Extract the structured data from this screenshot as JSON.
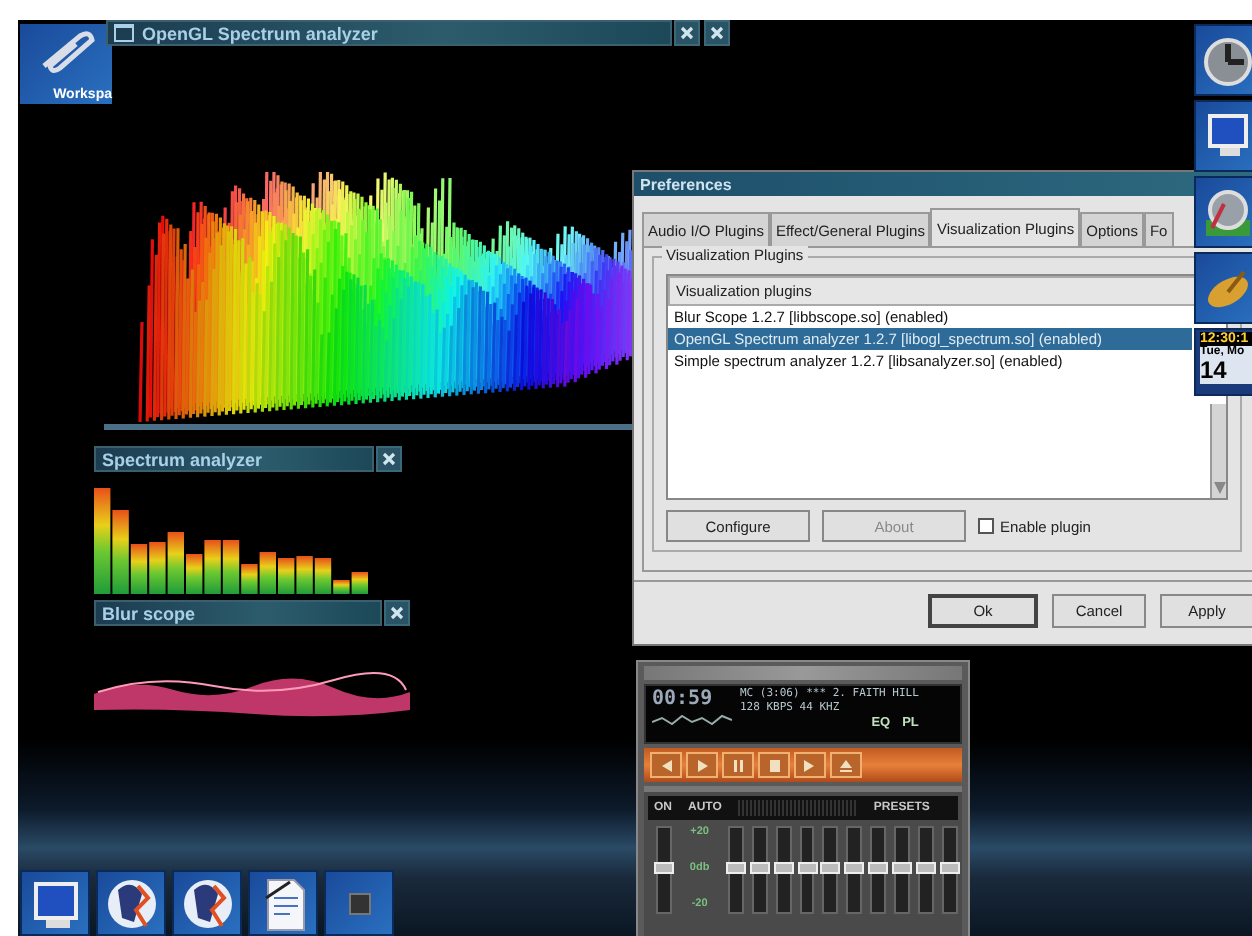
{
  "clip": {
    "label": "Workspa"
  },
  "gl_window": {
    "title": "OpenGL Spectrum analyzer"
  },
  "spectrum_window": {
    "title": "Spectrum analyzer"
  },
  "blur_window": {
    "title": "Blur scope"
  },
  "preferences": {
    "title": "Preferences",
    "tabs": [
      {
        "label": "Audio I/O Plugins",
        "selected": false
      },
      {
        "label": "Effect/General Plugins",
        "selected": false
      },
      {
        "label": "Visualization Plugins",
        "selected": true
      },
      {
        "label": "Options",
        "selected": false
      },
      {
        "label": "Fo",
        "selected": false
      }
    ],
    "group_label": "Visualization Plugins",
    "list_header": "Visualization plugins",
    "rows": [
      {
        "text": "Blur Scope 1.2.7    [libbscope.so] (enabled)",
        "selected": false
      },
      {
        "text": "OpenGL Spectrum analyzer 1.2.7    [libogl_spectrum.so] (enabled)",
        "selected": true
      },
      {
        "text": "Simple spectrum analyzer 1.2.7    [libsanalyzer.so] (enabled)",
        "selected": false
      }
    ],
    "plugin_buttons": [
      {
        "label": "Configure",
        "disabled": false
      },
      {
        "label": "About",
        "disabled": true
      }
    ],
    "checkbox": {
      "label": "Enable plugin",
      "checked": false
    },
    "dialog_buttons": [
      {
        "label": "Ok",
        "default": true
      },
      {
        "label": "Cancel",
        "default": false
      },
      {
        "label": "Apply",
        "default": false
      }
    ]
  },
  "clock": {
    "time": "12:30:1",
    "date": "Tue, Mo",
    "day": "14"
  },
  "player": {
    "time": "00:59",
    "title": "MC (3:06)  ***  2. FAITH HILL",
    "rate": "128 KBPS  44 KHZ",
    "eq": "EQ",
    "pl": "PL"
  },
  "equalizer": {
    "on": "ON",
    "auto": "AUTO",
    "presets": "PRESETS",
    "scale": [
      "+20",
      "0db",
      "-20"
    ],
    "sliders": [
      {
        "level": 0.5
      },
      {
        "level": 0.5
      },
      {
        "level": 0.5
      },
      {
        "level": 0.5
      },
      {
        "level": 0.5
      },
      {
        "level": 0.5
      },
      {
        "level": 0.5
      },
      {
        "level": 0.5
      },
      {
        "level": 0.5
      },
      {
        "level": 0.5
      },
      {
        "level": 0.5
      }
    ]
  }
}
